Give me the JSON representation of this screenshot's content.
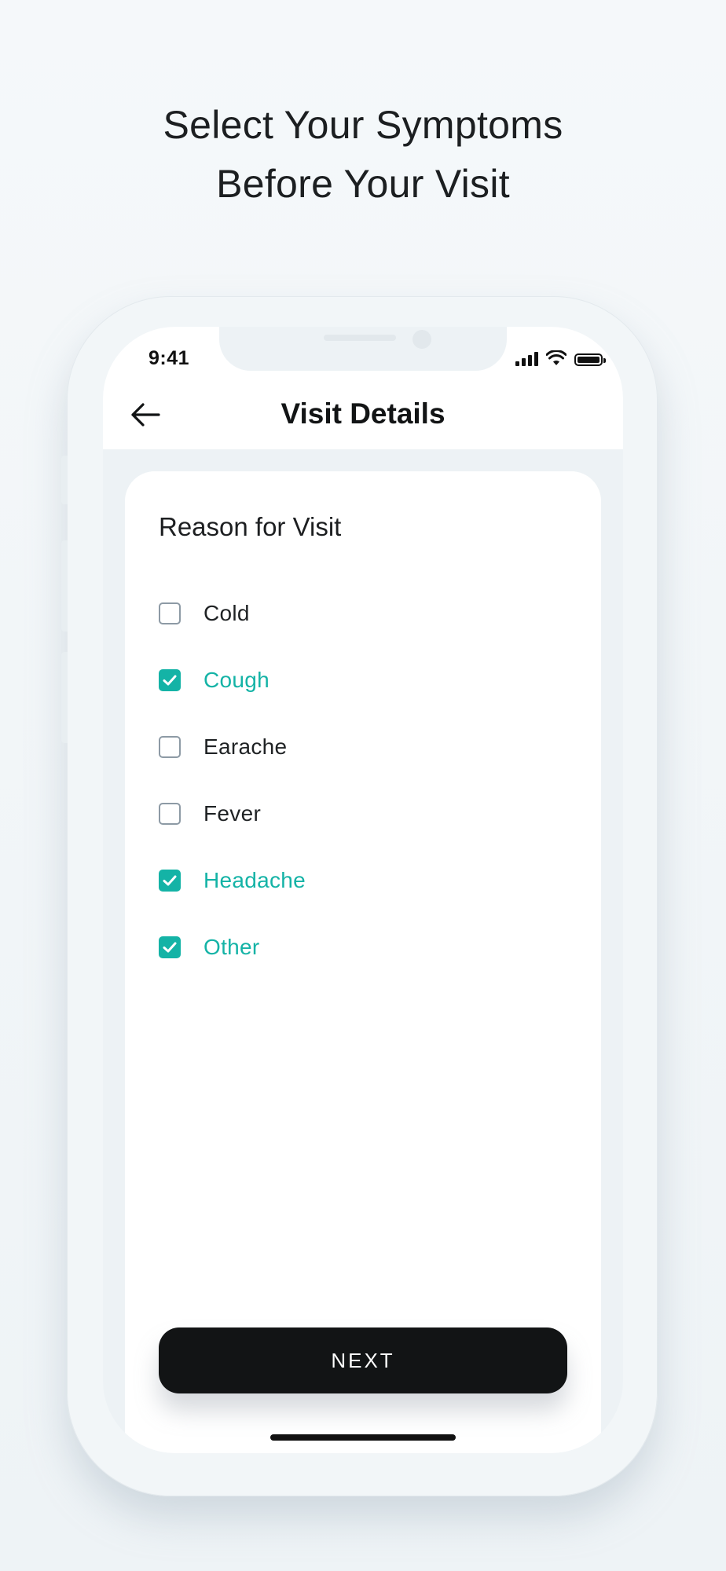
{
  "headline": {
    "line1": "Select Your Symptoms",
    "line2": "Before Your Visit"
  },
  "status_bar": {
    "time": "9:41",
    "icons": [
      "signal-icon",
      "wifi-icon",
      "battery-icon"
    ]
  },
  "nav": {
    "back_icon": "arrow-left-icon",
    "title": "Visit Details"
  },
  "form": {
    "section_title": "Reason for Visit",
    "options": [
      {
        "label": "Cold",
        "checked": false
      },
      {
        "label": "Cough",
        "checked": true
      },
      {
        "label": "Earache",
        "checked": false
      },
      {
        "label": "Fever",
        "checked": false
      },
      {
        "label": "Headache",
        "checked": true
      },
      {
        "label": "Other",
        "checked": true
      }
    ]
  },
  "next_button": {
    "label": "NEXT"
  },
  "colors": {
    "accent": "#14b3a6",
    "button": "#121415",
    "text": "#1f2224",
    "unchecked_border": "#8d9aa5"
  }
}
